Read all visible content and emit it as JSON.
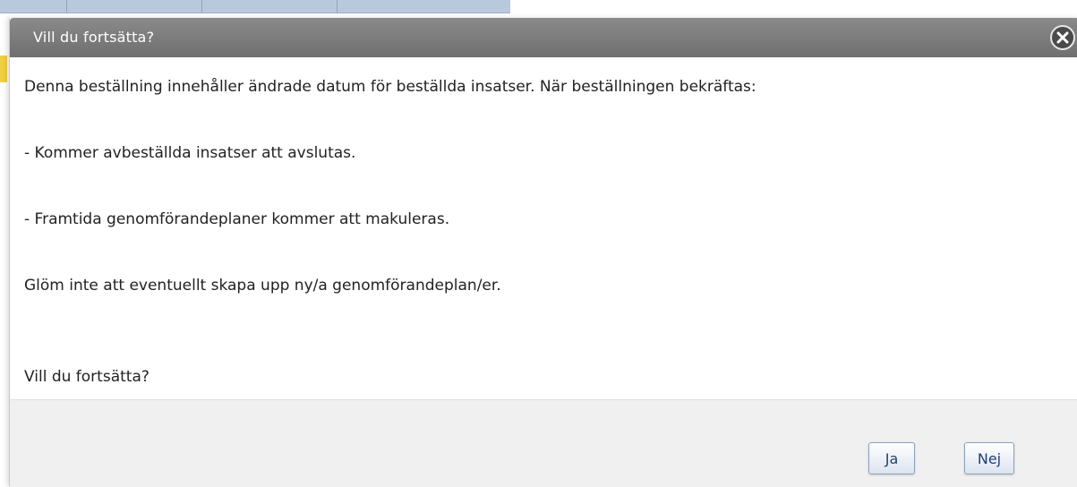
{
  "dialog": {
    "title": "Vill du fortsätta?",
    "close_icon": "close-icon",
    "messages": [
      "Denna beställning innehåller ändrade datum för beställda insatser. När beställningen bekräftas:",
      "- Kommer avbeställda insatser att avslutas.",
      "- Framtida genomförandeplaner kommer att makuleras.",
      "Glöm inte att eventuellt skapa upp ny/a genomförandeplan/er.",
      "Vill du fortsätta?"
    ],
    "buttons": {
      "yes_label": "Ja",
      "no_label": "Nej"
    }
  },
  "colors": {
    "titlebar": "#7d7d7d",
    "footer": "#f0f0f0",
    "button_text": "#1f3f73"
  }
}
